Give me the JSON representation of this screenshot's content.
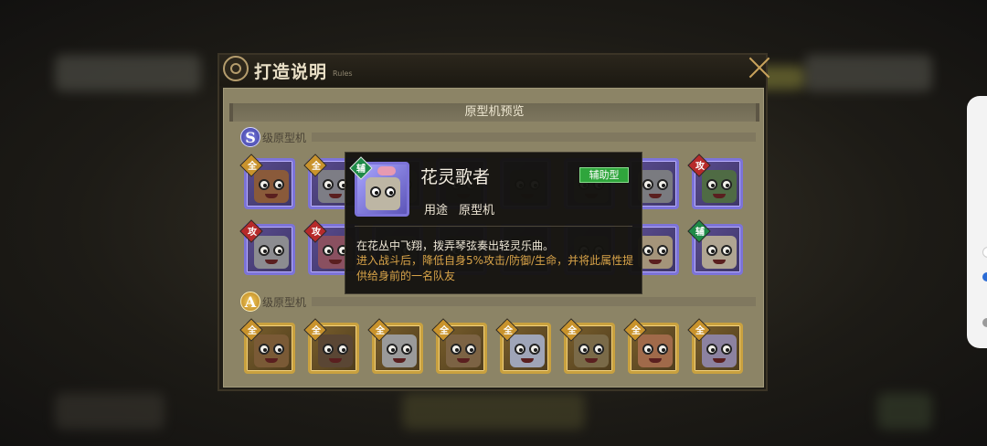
{
  "dialog": {
    "title": "打造说明",
    "subtitle": "Rules",
    "section_header": "原型机预览",
    "s_tier": {
      "badge": "S",
      "label": "级原型机"
    },
    "a_tier": {
      "badge": "A",
      "label": "级原型机"
    }
  },
  "s_units": [
    {
      "tag": "全",
      "tag_color": "#c9932c"
    },
    {
      "tag": "全",
      "tag_color": "#c9932c"
    },
    {
      "tag": "",
      "tag_color": ""
    },
    {
      "tag": "",
      "tag_color": ""
    },
    {
      "tag": "",
      "tag_color": ""
    },
    {
      "tag": "",
      "tag_color": ""
    },
    {
      "tag": "",
      "tag_color": ""
    },
    {
      "tag": "攻",
      "tag_color": "#b72a2a"
    },
    {
      "tag": "攻",
      "tag_color": "#b72a2a"
    },
    {
      "tag": "攻",
      "tag_color": "#b72a2a"
    },
    {
      "tag": "",
      "tag_color": ""
    },
    {
      "tag": "",
      "tag_color": ""
    },
    {
      "tag": "",
      "tag_color": ""
    },
    {
      "tag": "",
      "tag_color": ""
    },
    {
      "tag": "",
      "tag_color": ""
    },
    {
      "tag": "辅",
      "tag_color": "#1f8a48"
    }
  ],
  "a_units": [
    {
      "tag": "全"
    },
    {
      "tag": "全"
    },
    {
      "tag": "全"
    },
    {
      "tag": "全"
    },
    {
      "tag": "全"
    },
    {
      "tag": "全"
    },
    {
      "tag": "全"
    },
    {
      "tag": "全"
    }
  ],
  "tooltip": {
    "icon_tag": "辅",
    "name": "花灵歌者",
    "type_badge": "辅助型",
    "use_label": "用途",
    "use_value": "原型机",
    "description": "在花丛中飞翔，拨弄琴弦奏出轻灵乐曲。",
    "effect": "进入战斗后，降低自身5%攻击/防御/生命，并将此属性提供给身前的一名队友"
  },
  "colors": {
    "s_frame": "#7c73d8",
    "a_frame": "#c9a13f",
    "support_green": "#2fa53c",
    "effect_text": "#d9a449"
  }
}
